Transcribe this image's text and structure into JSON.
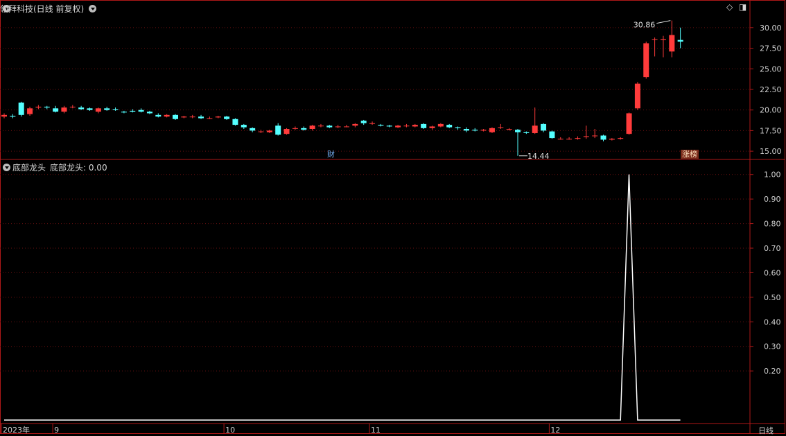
{
  "header": {
    "main_title": "领拜科技(日线 前复权)",
    "indicator_title": "底部龙头",
    "indicator_value_label": "底部龙头: 0.00",
    "period_label": "日线"
  },
  "markers": {
    "high_label": "30.86",
    "low_label": "14.44",
    "event_cai": "财",
    "event_zhangbang": "涨榜"
  },
  "colors": {
    "up": "#ff3b3b",
    "down": "#54ffff",
    "border": "#b01818",
    "grid": "#6a1010",
    "line": "#ffffff"
  },
  "chart_data": [
    {
      "type": "candlestick",
      "ylim": [
        14.0,
        31.5
      ],
      "yticks": [
        "30.00",
        "27.50",
        "25.00",
        "22.50",
        "20.00",
        "17.50",
        "15.00"
      ],
      "grid": true,
      "candles": [
        [
          19.2,
          19.4,
          19.6,
          19.0
        ],
        [
          19.3,
          19.2,
          19.5,
          19.0
        ],
        [
          20.9,
          19.4,
          21.0,
          19.2
        ],
        [
          19.5,
          20.2,
          20.4,
          19.3
        ],
        [
          20.3,
          20.4,
          20.6,
          20.1
        ],
        [
          20.4,
          20.3,
          20.5,
          20.1
        ],
        [
          20.2,
          19.8,
          20.5,
          19.7
        ],
        [
          19.8,
          20.3,
          20.5,
          19.6
        ],
        [
          20.4,
          20.4,
          20.6,
          20.2
        ],
        [
          20.3,
          20.1,
          20.5,
          20.0
        ],
        [
          20.2,
          20.0,
          20.3,
          19.9
        ],
        [
          19.8,
          20.2,
          20.3,
          19.6
        ],
        [
          20.2,
          20.0,
          20.4,
          19.9
        ],
        [
          20.1,
          20.0,
          20.3,
          19.9
        ],
        [
          19.8,
          19.7,
          19.9,
          19.6
        ],
        [
          19.9,
          19.8,
          20.1,
          19.7
        ],
        [
          20.0,
          19.8,
          20.2,
          19.7
        ],
        [
          19.8,
          19.6,
          19.9,
          19.5
        ],
        [
          19.4,
          19.2,
          19.6,
          19.1
        ],
        [
          19.2,
          19.4,
          19.5,
          19.1
        ],
        [
          19.4,
          18.9,
          19.5,
          18.8
        ],
        [
          19.1,
          19.2,
          19.3,
          19.0
        ],
        [
          19.2,
          19.2,
          19.4,
          19.0
        ],
        [
          19.2,
          19.0,
          19.4,
          18.9
        ],
        [
          19.0,
          19.0,
          19.2,
          18.9
        ],
        [
          19.1,
          19.2,
          19.3,
          19.0
        ],
        [
          19.2,
          18.9,
          19.3,
          18.8
        ],
        [
          18.9,
          18.2,
          19.0,
          18.1
        ],
        [
          18.2,
          17.9,
          18.3,
          17.7
        ],
        [
          17.8,
          17.5,
          17.9,
          17.3
        ],
        [
          17.4,
          17.4,
          17.6,
          17.2
        ],
        [
          17.3,
          17.5,
          17.6,
          17.2
        ],
        [
          18.1,
          17.0,
          18.4,
          16.9
        ],
        [
          17.1,
          17.7,
          17.8,
          17.0
        ],
        [
          17.8,
          17.8,
          18.0,
          17.6
        ],
        [
          17.8,
          17.6,
          18.0,
          17.5
        ],
        [
          17.7,
          18.1,
          18.2,
          17.5
        ],
        [
          18.1,
          18.1,
          18.3,
          17.9
        ],
        [
          18.1,
          17.9,
          18.2,
          17.8
        ],
        [
          18.0,
          18.0,
          18.2,
          17.8
        ],
        [
          18.0,
          18.0,
          18.2,
          17.9
        ],
        [
          18.1,
          18.3,
          18.4,
          17.9
        ],
        [
          18.7,
          18.4,
          18.8,
          18.2
        ],
        [
          18.4,
          18.4,
          18.6,
          18.2
        ],
        [
          18.2,
          18.1,
          18.3,
          18.0
        ],
        [
          18.1,
          18.0,
          18.2,
          17.9
        ],
        [
          17.9,
          18.1,
          18.2,
          17.8
        ],
        [
          18.1,
          18.1,
          18.3,
          17.9
        ],
        [
          18.0,
          18.2,
          18.3,
          17.9
        ],
        [
          18.3,
          17.8,
          18.4,
          17.7
        ],
        [
          17.8,
          18.0,
          18.1,
          17.6
        ],
        [
          18.0,
          18.3,
          18.4,
          17.9
        ],
        [
          18.2,
          17.9,
          18.3,
          17.8
        ],
        [
          17.9,
          17.8,
          18.0,
          17.6
        ],
        [
          17.7,
          17.5,
          17.9,
          17.3
        ],
        [
          17.6,
          17.5,
          17.8,
          17.4
        ],
        [
          17.5,
          17.6,
          17.7,
          17.4
        ],
        [
          17.3,
          17.8,
          17.9,
          17.2
        ],
        [
          17.9,
          17.9,
          18.3,
          17.7
        ],
        [
          17.7,
          17.7,
          17.8,
          17.5
        ],
        [
          17.6,
          17.3,
          17.7,
          14.44
        ],
        [
          17.3,
          17.2,
          17.4,
          17.1
        ],
        [
          17.2,
          18.1,
          20.3,
          17.1
        ],
        [
          18.3,
          17.5,
          18.4,
          17.3
        ],
        [
          17.4,
          16.6,
          17.5,
          16.5
        ],
        [
          16.5,
          16.5,
          16.7,
          16.4
        ],
        [
          16.5,
          16.5,
          16.7,
          16.4
        ],
        [
          16.5,
          16.6,
          16.8,
          16.4
        ],
        [
          16.7,
          16.8,
          18.1,
          16.5
        ],
        [
          16.9,
          16.9,
          17.7,
          16.6
        ],
        [
          16.9,
          16.4,
          17.0,
          16.2
        ],
        [
          16.4,
          16.5,
          16.6,
          16.3
        ],
        [
          16.5,
          16.6,
          16.7,
          16.4
        ],
        [
          17.1,
          19.6,
          19.7,
          17.0
        ],
        [
          20.2,
          23.2,
          23.4,
          20.0
        ],
        [
          24.0,
          28.1,
          28.3,
          23.8
        ],
        [
          28.6,
          28.6,
          28.8,
          26.5
        ],
        [
          28.5,
          28.6,
          29.0,
          26.4
        ],
        [
          27.1,
          29.1,
          30.86,
          26.4
        ],
        [
          28.5,
          28.3,
          30.0,
          27.5
        ]
      ]
    },
    {
      "type": "line",
      "name": "底部龙头",
      "ylim": [
        0.0,
        1.05
      ],
      "yticks": [
        "1.00",
        "0.90",
        "0.80",
        "0.70",
        "0.60",
        "0.50",
        "0.40",
        "0.30",
        "0.20"
      ],
      "grid": true,
      "values": [
        0,
        0,
        0,
        0,
        0,
        0,
        0,
        0,
        0,
        0,
        0,
        0,
        0,
        0,
        0,
        0,
        0,
        0,
        0,
        0,
        0,
        0,
        0,
        0,
        0,
        0,
        0,
        0,
        0,
        0,
        0,
        0,
        0,
        0,
        0,
        0,
        0,
        0,
        0,
        0,
        0,
        0,
        0,
        0,
        0,
        0,
        0,
        0,
        0,
        0,
        0,
        0,
        0,
        0,
        0,
        0,
        0,
        0,
        0,
        0,
        0,
        0,
        0,
        0,
        0,
        0,
        0,
        0,
        0,
        0,
        0,
        0,
        0,
        1,
        0,
        0,
        0,
        0,
        0,
        0
      ],
      "x_labels": [
        "2023年",
        "9",
        "10",
        "11",
        "12"
      ]
    }
  ]
}
